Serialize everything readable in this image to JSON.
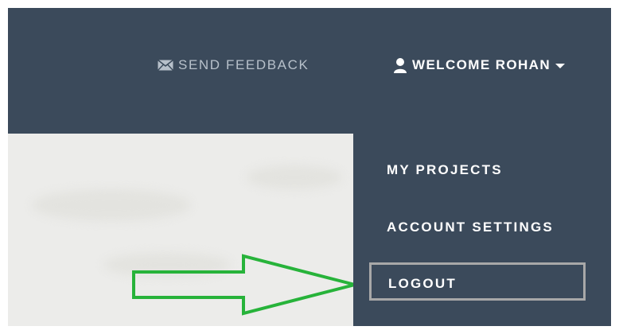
{
  "navbar": {
    "feedback_label": "SEND FEEDBACK",
    "feedback_icon": "envelope-icon",
    "welcome_label": "WELCOME ROHAN",
    "welcome_icon": "user-icon",
    "bg_color": "#3b4a5b"
  },
  "dropdown": {
    "items": [
      {
        "label": "MY PROJECTS"
      },
      {
        "label": "ACCOUNT SETTINGS"
      },
      {
        "label": "LOGOUT"
      }
    ],
    "highlight_color": "#a8a8a8"
  },
  "annotation": {
    "arrow_color": "#27b33a",
    "arrow_icon": "arrow-right-icon"
  }
}
